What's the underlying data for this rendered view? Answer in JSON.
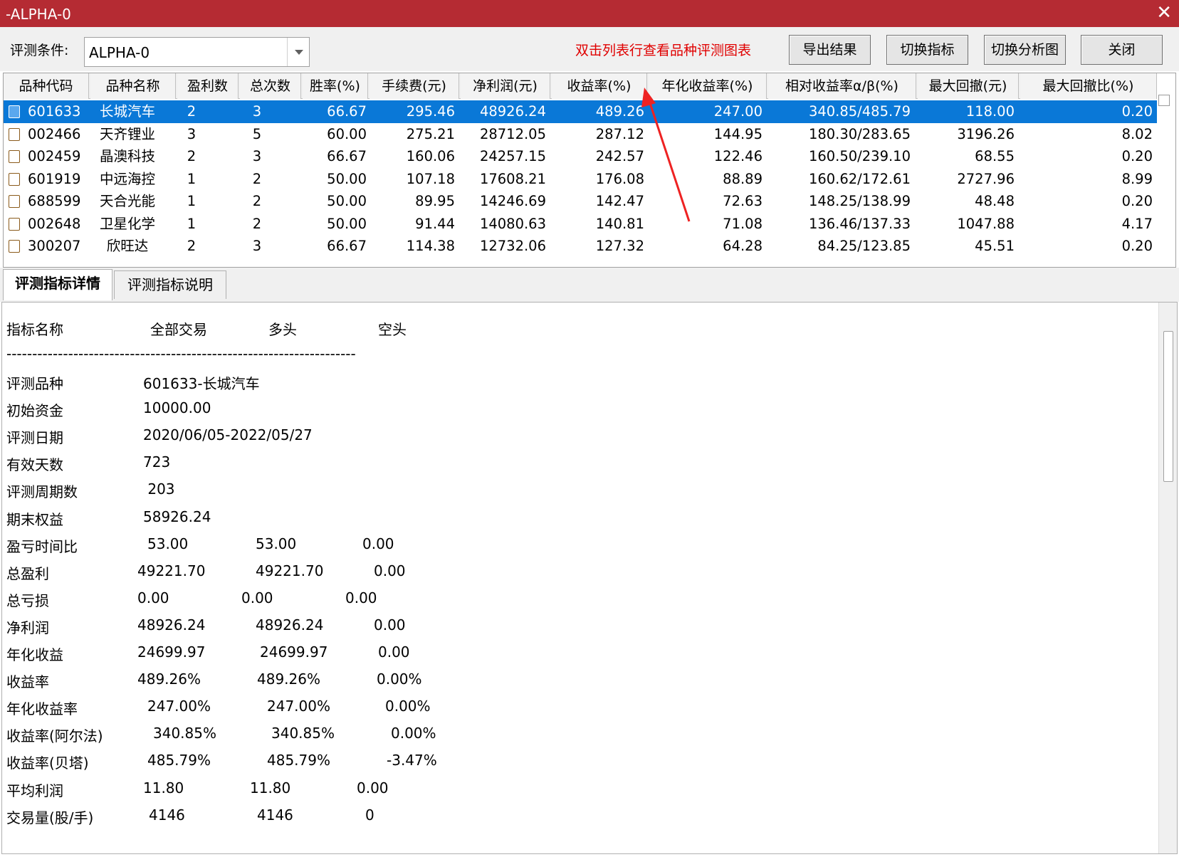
{
  "window": {
    "title": "-ALPHA-0",
    "close_glyph": "✕"
  },
  "toolbar": {
    "cond_label": "评测条件:",
    "cond_value": "ALPHA-0",
    "hint": "双击列表行查看品种评测图表",
    "buttons": {
      "export": "导出结果",
      "switch_metric": "切换指标",
      "switch_chart": "切换分析图",
      "close": "关闭"
    }
  },
  "table": {
    "headers": [
      "品种代码",
      "品种名称",
      "盈利数",
      "总次数",
      "胜率(%)",
      "手续费(元)",
      "净利润(元)",
      "收益率(%)",
      "年化收益率(%)",
      "相对收益率α/β(%)",
      "最大回撤(元)",
      "最大回撤比(%)"
    ],
    "rows": [
      {
        "code": "601633",
        "name": "长城汽车",
        "win": "2",
        "total": "3",
        "rate": "66.67",
        "fee": "295.46",
        "profit": "48926.24",
        "ret": "489.26",
        "annual": "247.00",
        "ab": "340.85/485.79",
        "dd": "118.00",
        "ddr": "0.20",
        "selected": true
      },
      {
        "code": "002466",
        "name": "天齐锂业",
        "win": "3",
        "total": "5",
        "rate": "60.00",
        "fee": "275.21",
        "profit": "28712.05",
        "ret": "287.12",
        "annual": "144.95",
        "ab": "180.30/283.65",
        "dd": "3196.26",
        "ddr": "8.02"
      },
      {
        "code": "002459",
        "name": "晶澳科技",
        "win": "2",
        "total": "3",
        "rate": "66.67",
        "fee": "160.06",
        "profit": "24257.15",
        "ret": "242.57",
        "annual": "122.46",
        "ab": "160.50/239.10",
        "dd": "68.55",
        "ddr": "0.20"
      },
      {
        "code": "601919",
        "name": "中远海控",
        "win": "1",
        "total": "2",
        "rate": "50.00",
        "fee": "107.18",
        "profit": "17608.21",
        "ret": "176.08",
        "annual": "88.89",
        "ab": "160.62/172.61",
        "dd": "2727.96",
        "ddr": "8.99"
      },
      {
        "code": "688599",
        "name": "天合光能",
        "win": "1",
        "total": "2",
        "rate": "50.00",
        "fee": "89.95",
        "profit": "14246.69",
        "ret": "142.47",
        "annual": "72.63",
        "ab": "148.25/138.99",
        "dd": "48.48",
        "ddr": "0.20"
      },
      {
        "code": "002648",
        "name": "卫星化学",
        "win": "1",
        "total": "2",
        "rate": "50.00",
        "fee": "91.44",
        "profit": "14080.63",
        "ret": "140.81",
        "annual": "71.08",
        "ab": "136.46/137.33",
        "dd": "1047.88",
        "ddr": "4.17"
      },
      {
        "code": "300207",
        "name": "欣旺达",
        "win": "2",
        "total": "3",
        "rate": "66.67",
        "fee": "114.38",
        "profit": "12732.06",
        "ret": "127.32",
        "annual": "64.28",
        "ab": "84.25/123.85",
        "dd": "45.51",
        "ddr": "0.20"
      }
    ]
  },
  "tabs": [
    "评测指标详情",
    "评测指标说明"
  ],
  "detail": {
    "header": {
      "name": "指标名称",
      "all": "全部交易",
      "long": "多头",
      "short": "空头"
    },
    "separator": "--------------------------------------------------------------------",
    "info": [
      {
        "label": "评测品种",
        "value": "601633-长城汽车"
      },
      {
        "label": "初始资金",
        "value": "10000.00"
      },
      {
        "label": "评测日期",
        "value": "2020/06/05-2022/05/27"
      },
      {
        "label": "有效天数",
        "value": "723"
      },
      {
        "label": "评测周期数",
        "value": " 203"
      },
      {
        "label": "期末权益",
        "value": "58926.24"
      }
    ],
    "metrics": [
      {
        "label": "盈亏时间比",
        "all": "53.00",
        "long": "53.00",
        "short": "0.00"
      },
      {
        "label": "总盈利",
        "all": "49221.70",
        "long": "49221.70",
        "short": "0.00"
      },
      {
        "label": "总亏损",
        "all": "0.00",
        "long": "0.00",
        "short": "0.00"
      },
      {
        "label": "净利润",
        "all": "48926.24",
        "long": "48926.24",
        "short": "0.00"
      },
      {
        "label": "年化收益",
        "all": "24699.97",
        "long": "24699.97",
        "short": "0.00"
      },
      {
        "label": "收益率",
        "all": "489.26%",
        "long": "489.26%",
        "short": "0.00%"
      },
      {
        "label": "年化收益率",
        "all": "247.00%",
        "long": "247.00%",
        "short": "0.00%"
      },
      {
        "label": "收益率(阿尔法)",
        "all": "340.85%",
        "long": "340.85%",
        "short": "0.00%"
      },
      {
        "label": "收益率(贝塔)",
        "all": "485.79%",
        "long": "485.79%",
        "short": "-3.47%"
      },
      {
        "label": "平均利润",
        "all": "11.80",
        "long": "11.80",
        "short": "0.00"
      },
      {
        "label": "交易量(股/手)",
        "all": "4146",
        "long": "4146",
        "short": "0"
      }
    ]
  },
  "colors": {
    "titlebar": "#b52b33",
    "selection": "#0a78d7",
    "hint": "#e00000",
    "annotation_arrow": "#ee2222"
  }
}
